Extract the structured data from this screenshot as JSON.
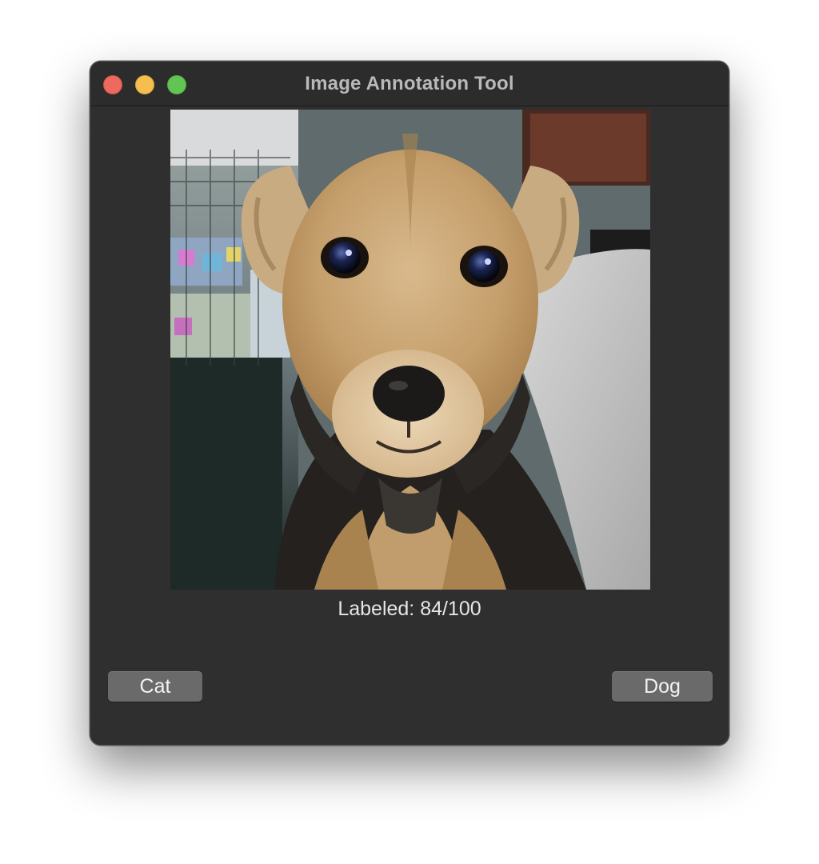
{
  "window": {
    "title": "Image Annotation Tool"
  },
  "main": {
    "status_text": "Labeled: 84/100",
    "image": {
      "subject": "photo of a tan and black puppy"
    }
  },
  "buttons": {
    "cat_label": "Cat",
    "dog_label": "Dog"
  },
  "colors": {
    "window_bg": "#2f2f2f",
    "titlebar_bg": "#2c2c2c",
    "button_bg": "#6a6a6a",
    "close": "#ed6a5e",
    "minimize": "#f5bf4f",
    "zoom": "#61c554"
  }
}
